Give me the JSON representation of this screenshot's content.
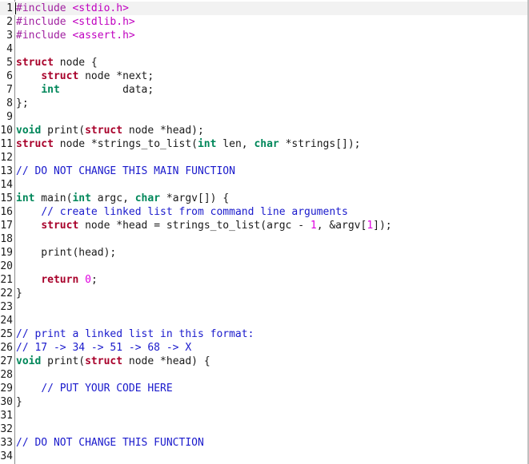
{
  "editor": {
    "lines": [
      {
        "n": "1",
        "tokens": [
          {
            "t": "#include ",
            "c": "pre"
          },
          {
            "t": "<stdio.h>",
            "c": "str"
          }
        ]
      },
      {
        "n": "2",
        "tokens": [
          {
            "t": "#include ",
            "c": "pre"
          },
          {
            "t": "<stdlib.h>",
            "c": "str"
          }
        ]
      },
      {
        "n": "3",
        "tokens": [
          {
            "t": "#include ",
            "c": "pre"
          },
          {
            "t": "<assert.h>",
            "c": "str"
          }
        ]
      },
      {
        "n": "4",
        "tokens": []
      },
      {
        "n": "5",
        "tokens": [
          {
            "t": "struct",
            "c": "kw"
          },
          {
            "t": " node {",
            "c": "plain"
          }
        ]
      },
      {
        "n": "6",
        "tokens": [
          {
            "t": "    ",
            "c": "plain"
          },
          {
            "t": "struct",
            "c": "kw"
          },
          {
            "t": " node *next;",
            "c": "plain"
          }
        ]
      },
      {
        "n": "7",
        "tokens": [
          {
            "t": "    ",
            "c": "plain"
          },
          {
            "t": "int",
            "c": "type"
          },
          {
            "t": "          data;",
            "c": "plain"
          }
        ]
      },
      {
        "n": "8",
        "tokens": [
          {
            "t": "};",
            "c": "plain"
          }
        ]
      },
      {
        "n": "9",
        "tokens": []
      },
      {
        "n": "10",
        "tokens": [
          {
            "t": "void",
            "c": "type"
          },
          {
            "t": " print(",
            "c": "plain"
          },
          {
            "t": "struct",
            "c": "kw"
          },
          {
            "t": " node *head);",
            "c": "plain"
          }
        ]
      },
      {
        "n": "11",
        "tokens": [
          {
            "t": "struct",
            "c": "kw"
          },
          {
            "t": " node *strings_to_list(",
            "c": "plain"
          },
          {
            "t": "int",
            "c": "type"
          },
          {
            "t": " len, ",
            "c": "plain"
          },
          {
            "t": "char",
            "c": "type"
          },
          {
            "t": " *strings[]);",
            "c": "plain"
          }
        ]
      },
      {
        "n": "12",
        "tokens": []
      },
      {
        "n": "13",
        "tokens": [
          {
            "t": "// DO NOT CHANGE THIS MAIN FUNCTION",
            "c": "com"
          }
        ]
      },
      {
        "n": "14",
        "tokens": []
      },
      {
        "n": "15",
        "tokens": [
          {
            "t": "int",
            "c": "type"
          },
          {
            "t": " main(",
            "c": "plain"
          },
          {
            "t": "int",
            "c": "type"
          },
          {
            "t": " argc, ",
            "c": "plain"
          },
          {
            "t": "char",
            "c": "type"
          },
          {
            "t": " *argv[]) {",
            "c": "plain"
          }
        ]
      },
      {
        "n": "16",
        "tokens": [
          {
            "t": "    ",
            "c": "plain"
          },
          {
            "t": "// create linked list from command line arguments",
            "c": "com"
          }
        ]
      },
      {
        "n": "17",
        "tokens": [
          {
            "t": "    ",
            "c": "plain"
          },
          {
            "t": "struct",
            "c": "kw"
          },
          {
            "t": " node *head = strings_to_list(argc - ",
            "c": "plain"
          },
          {
            "t": "1",
            "c": "num"
          },
          {
            "t": ", &argv[",
            "c": "plain"
          },
          {
            "t": "1",
            "c": "num"
          },
          {
            "t": "]);",
            "c": "plain"
          }
        ]
      },
      {
        "n": "18",
        "tokens": []
      },
      {
        "n": "19",
        "tokens": [
          {
            "t": "    print(head);",
            "c": "plain"
          }
        ]
      },
      {
        "n": "20",
        "tokens": []
      },
      {
        "n": "21",
        "tokens": [
          {
            "t": "    ",
            "c": "plain"
          },
          {
            "t": "return",
            "c": "kw"
          },
          {
            "t": " ",
            "c": "plain"
          },
          {
            "t": "0",
            "c": "num"
          },
          {
            "t": ";",
            "c": "plain"
          }
        ]
      },
      {
        "n": "22",
        "tokens": [
          {
            "t": "}",
            "c": "plain"
          }
        ]
      },
      {
        "n": "23",
        "tokens": []
      },
      {
        "n": "24",
        "tokens": []
      },
      {
        "n": "25",
        "tokens": [
          {
            "t": "// print a linked list in this format:",
            "c": "com"
          }
        ]
      },
      {
        "n": "26",
        "tokens": [
          {
            "t": "// 17 -> 34 -> 51 -> 68 -> X",
            "c": "com"
          }
        ]
      },
      {
        "n": "27",
        "tokens": [
          {
            "t": "void",
            "c": "type"
          },
          {
            "t": " print(",
            "c": "plain"
          },
          {
            "t": "struct",
            "c": "kw"
          },
          {
            "t": " node *head) {",
            "c": "plain"
          }
        ]
      },
      {
        "n": "28",
        "tokens": []
      },
      {
        "n": "29",
        "tokens": [
          {
            "t": "    ",
            "c": "plain"
          },
          {
            "t": "// PUT YOUR CODE HERE",
            "c": "com"
          }
        ]
      },
      {
        "n": "30",
        "tokens": [
          {
            "t": "}",
            "c": "plain"
          }
        ]
      },
      {
        "n": "31",
        "tokens": []
      },
      {
        "n": "32",
        "tokens": []
      },
      {
        "n": "33",
        "tokens": [
          {
            "t": "// DO NOT CHANGE THIS FUNCTION",
            "c": "com"
          }
        ]
      },
      {
        "n": "34",
        "tokens": []
      }
    ],
    "current_line": "1"
  },
  "colors": {
    "preprocessor": "#a020a0",
    "string": "#c000c0",
    "keyword": "#a8002a",
    "type": "#00875a",
    "comment": "#1a1acc",
    "number": "#e000e0",
    "text": "#1a1a1a"
  }
}
